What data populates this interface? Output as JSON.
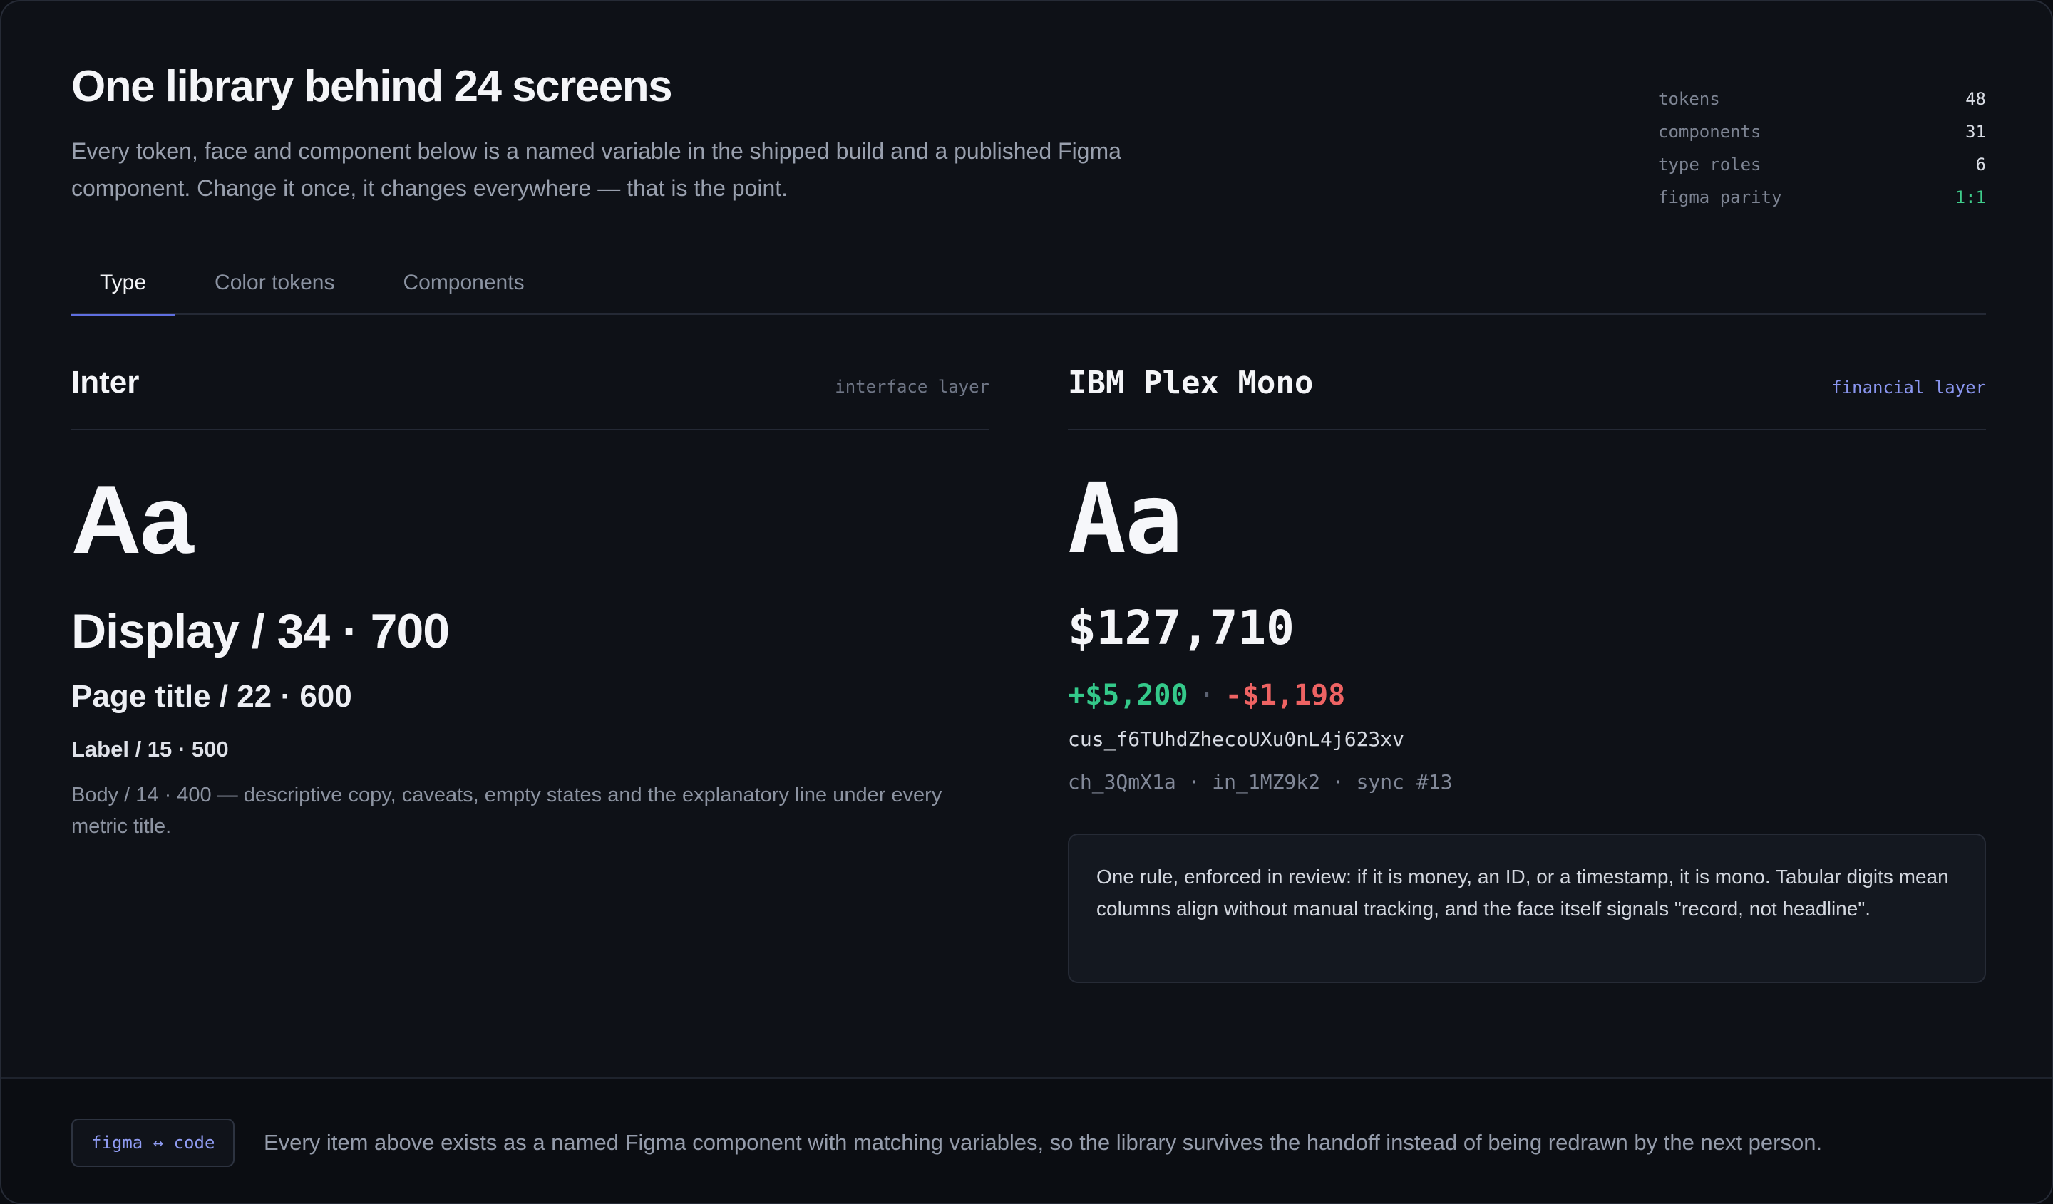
{
  "header": {
    "title": "One library behind 24 screens",
    "subtitle": "Every token, face and component below is a named variable in the shipped build and a published Figma component. Change it once, it changes everywhere — that is the point."
  },
  "stats": [
    {
      "key": "tokens",
      "value": "48"
    },
    {
      "key": "components",
      "value": "31"
    },
    {
      "key": "type roles",
      "value": "6"
    },
    {
      "key": "figma parity",
      "value": "1:1"
    }
  ],
  "tabs": [
    {
      "label": "Type",
      "active": true
    },
    {
      "label": "Color tokens",
      "active": false
    },
    {
      "label": "Components",
      "active": false
    }
  ],
  "inter": {
    "name": "Inter",
    "layer": "interface layer",
    "specimen": "Aa",
    "display": "Display / 34 · 700",
    "page_title": "Page title / 22 · 600",
    "label": "Label / 15 · 500",
    "body": "Body / 14 · 400 — descriptive copy, caveats, empty states and the explanatory line under every metric title."
  },
  "plex": {
    "name": "IBM Plex Mono",
    "layer": "financial layer",
    "specimen": "Aa",
    "amount": "$127,710",
    "delta_pos": "+$5,200",
    "delta_sep": "·",
    "delta_neg": "-$1,198",
    "customer_id": "cus_f6TUhdZhecoUXu0nL4j623xv",
    "refs": "ch_3QmX1a · in_1MZ9k2 · sync #13",
    "rule": "One rule, enforced in review: if it is money, an ID, or a timestamp, it is mono. Tabular digits mean columns align without manual tracking, and the face itself signals \"record, not headline\"."
  },
  "footer": {
    "badge": "figma ↔ code",
    "text": "Every item above exists as a named Figma component with matching variables, so the library survives the handoff instead of being redrawn by the next person."
  },
  "colors": {
    "accent": "#5f6fe0",
    "positive": "#34c98a",
    "negative": "#ee6363",
    "background": "#0e1117"
  }
}
